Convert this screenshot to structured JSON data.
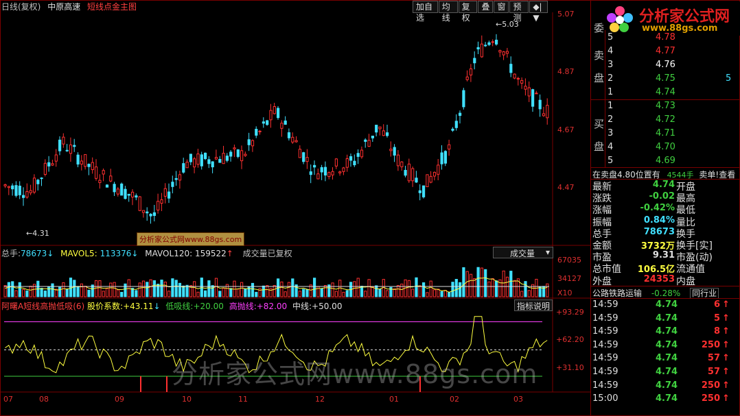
{
  "header": {
    "period": "日线(复权)",
    "stock_name": "中原高速",
    "indicator": "短线点金主图"
  },
  "toolbar": [
    "加自选",
    "均线",
    "复权",
    "叠",
    "窗",
    "预测",
    "◆|▼"
  ],
  "price_axis": [
    "5.07",
    "4.87",
    "4.67",
    "4.47"
  ],
  "price_annotations": {
    "high": "5.03",
    "low": "4.31"
  },
  "main_badge": "分析家公式网www.88gs.com",
  "volume_header": {
    "total_label": "总手:",
    "total_value": "78673",
    "mavol5_label": "MAVOL5:",
    "mavol5_value": "113376",
    "mavol120_label": "MAVOL120:",
    "mavol120_value": "159522",
    "note": "成交量已复权",
    "dropdown": "成交量"
  },
  "volume_axis": [
    "67035",
    "34127",
    "X10"
  ],
  "indicator_header": {
    "name": "阿曙A短线高抛低吸(6)",
    "coef_label": "股价系数:",
    "coef_value": "+43.11",
    "low_label": "低吸线:",
    "low_value": "+20.00",
    "high_label": "高抛线:",
    "high_value": "+82.00",
    "mid_label": "中线:",
    "mid_value": "+50.00",
    "help": "指标说明"
  },
  "indicator_axis": [
    "+93.29",
    "+62.20",
    "+31.10"
  ],
  "x_axis": [
    "07",
    "08",
    "09",
    "10",
    "11",
    "12",
    "01",
    "02",
    "03"
  ],
  "watermark": "分析家公式网www.88gs.com",
  "logo": {
    "title": "分析家公式网",
    "url": "www.88gs.com"
  },
  "order_book": {
    "sell_chars": [
      "委",
      "卖",
      "盘"
    ],
    "buy_chars": [
      "买",
      "盘"
    ],
    "sells": [
      {
        "level": "5",
        "price": "4.78",
        "vol": ""
      },
      {
        "level": "4",
        "price": "4.77",
        "vol": ""
      },
      {
        "level": "3",
        "price": "4.76",
        "vol": ""
      },
      {
        "level": "2",
        "price": "4.75",
        "vol": "5"
      },
      {
        "level": "1",
        "price": "4.74",
        "vol": ""
      }
    ],
    "buys": [
      {
        "level": "1",
        "price": "4.73"
      },
      {
        "level": "2",
        "price": "4.72"
      },
      {
        "level": "3",
        "price": "4.71"
      },
      {
        "level": "4",
        "price": "4.70"
      },
      {
        "level": "5",
        "price": "4.69"
      }
    ],
    "notice": {
      "left": "在卖盘4.80位置有",
      "qty": "4544手",
      "right": "卖单!查看"
    }
  },
  "stats": [
    {
      "label": "最新",
      "value": "4.74",
      "label2": "开盘"
    },
    {
      "label": "涨跌",
      "value": "-0.02",
      "label2": "最高"
    },
    {
      "label": "涨幅",
      "value": "-0.42%",
      "label2": "最低"
    },
    {
      "label": "振幅",
      "value": "0.84%",
      "label2": "量比"
    },
    {
      "label": "总手",
      "value": "78673",
      "label2": "换手"
    },
    {
      "label": "金额",
      "value": "3732万",
      "label2": "换手[实]"
    },
    {
      "label": "市盈",
      "value": "9.31",
      "label2": "市盈(动)"
    },
    {
      "label": "总市值",
      "value": "106.5亿",
      "label2": "流通值"
    },
    {
      "label": "外盘",
      "value": "24353",
      "label2": "内盘"
    }
  ],
  "sector": {
    "name": "公路铁路运输",
    "change": "-0.28%",
    "peer": "同行业"
  },
  "ticks": [
    {
      "time": "14:59",
      "price": "4.74",
      "vol": "6"
    },
    {
      "time": "14:59",
      "price": "4.74",
      "vol": "5"
    },
    {
      "time": "14:59",
      "price": "4.74",
      "vol": "8"
    },
    {
      "time": "14:59",
      "price": "4.74",
      "vol": "250"
    },
    {
      "time": "14:59",
      "price": "4.74",
      "vol": "57"
    },
    {
      "time": "14:59",
      "price": "4.74",
      "vol": "57"
    },
    {
      "time": "14:59",
      "price": "4.74",
      "vol": "250"
    },
    {
      "time": "15:00",
      "price": "4.74",
      "vol": "250"
    }
  ],
  "colors": {
    "up": "#ff3030",
    "down": "#40e0ff",
    "grid": "#7a0000",
    "ma": "#ffff40",
    "magenta": "#ff40ff",
    "green": "#40d040"
  }
}
